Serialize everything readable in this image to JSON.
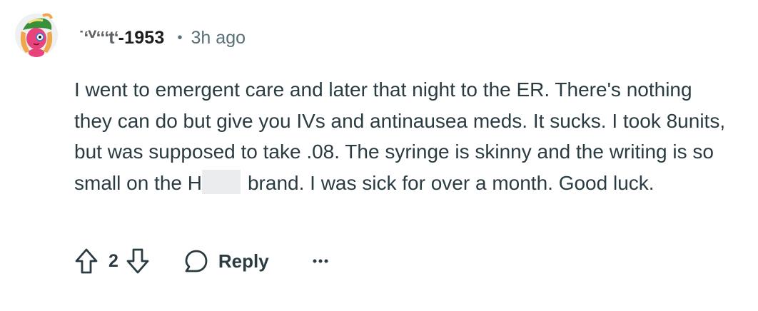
{
  "comment": {
    "author": {
      "masked_prefix": "˙ʻⱽʻʻʻtʻ",
      "suffix": "-1953"
    },
    "separator": "•",
    "time_ago": "3h ago",
    "body": {
      "line_part_1": "I went to emergent care and later that night to the ER. There's nothing they can do but give you IVs and antinausea meds. It sucks. I took 8units, but was supposed to take .08. The syringe is skinny and the writing is so small on the H",
      "line_part_2": "brand. I was sick for over a month. Good luck."
    },
    "actions": {
      "upvote_icon": "arrow-up-outline-icon",
      "vote_count": "2",
      "downvote_icon": "arrow-down-outline-icon",
      "reply_icon": "speech-bubble-icon",
      "reply_label": "Reply",
      "more_icon": "ellipsis-icon"
    },
    "avatar_icon": "snoo-avatar-icon",
    "colors": {
      "text": "#2a3c42",
      "meta": "#576f76",
      "redaction": "#ebecee",
      "avatar_skin": "#e8437a",
      "avatar_hat": "#3a8f3a"
    }
  }
}
